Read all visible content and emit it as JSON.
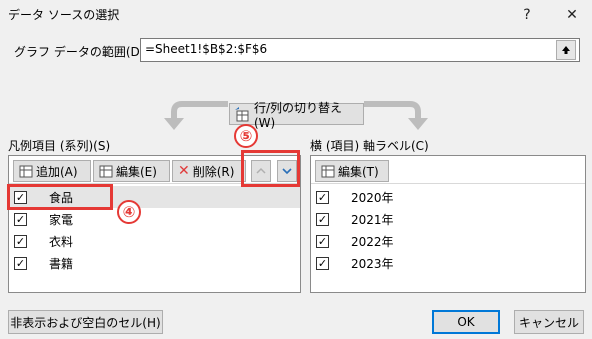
{
  "window": {
    "title": "データ ソースの選択",
    "help_label": "?",
    "close_label": "X"
  },
  "range": {
    "label": "グラフ データの範囲(D):",
    "value": "=Sheet1!$B$2:$F$6"
  },
  "switch_button_label": "行/列の切り替え(W)",
  "legend": {
    "label": "凡例項目 (系列)(S)",
    "add_label": "追加(A)",
    "edit_label": "編集(E)",
    "delete_label": "削除(R)",
    "items": [
      {
        "label": "食品",
        "checked": true
      },
      {
        "label": "家電",
        "checked": true
      },
      {
        "label": "衣料",
        "checked": true
      },
      {
        "label": "書籍",
        "checked": true
      }
    ]
  },
  "axis": {
    "label": "横 (項目) 軸ラベル(C)",
    "edit_label": "編集(T)",
    "items": [
      {
        "label": "2020年",
        "checked": true
      },
      {
        "label": "2021年",
        "checked": true
      },
      {
        "label": "2022年",
        "checked": true
      },
      {
        "label": "2023年",
        "checked": true
      }
    ]
  },
  "footer": {
    "hidden_cells_label": "非表示および空白のセル(H)",
    "ok_label": "OK",
    "cancel_label": "キャンセル"
  },
  "annotations": {
    "four": "④",
    "five": "⑤"
  },
  "colors": {
    "annotation": "#e53935",
    "delete_icon": "#e03a3a",
    "move_arrow": "#2a6fb8"
  }
}
